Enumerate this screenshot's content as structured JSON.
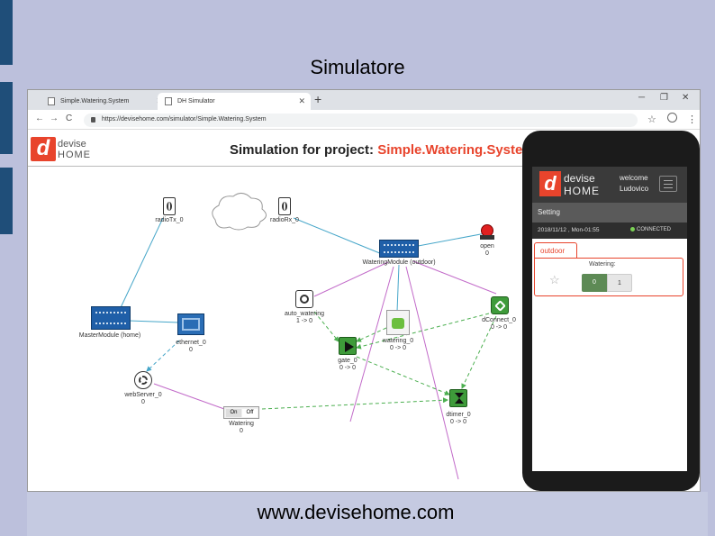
{
  "slide": {
    "title": "Simulatore",
    "footer_url": "www.devisehome.com"
  },
  "browser": {
    "tabs": [
      {
        "label": "Simple.Watering.System",
        "active": false
      },
      {
        "label": "DH Simulator",
        "active": true
      }
    ],
    "new_tab": "+",
    "window_controls": [
      "─",
      "❐",
      "✕"
    ],
    "nav": {
      "back": "←",
      "forward": "→",
      "reload": "C"
    },
    "address": "https://devisehome.com/simulator/Simple.Watering.System",
    "toolbar": {
      "star": "☆",
      "menu": "⋮"
    }
  },
  "app": {
    "logo": {
      "d": "d",
      "devise": "devise",
      "home": "HOME"
    },
    "title_prefix": "Simulation for project: ",
    "project_name": "Simple.Watering.System"
  },
  "nodes": [
    {
      "id": "radioTx",
      "label": "radioTx_0",
      "value": "",
      "icon": "radio-transmitter-icon"
    },
    {
      "id": "cloud",
      "label": "",
      "value": "",
      "icon": "cloud-icon"
    },
    {
      "id": "radioRx",
      "label": "radioRx_0",
      "value": "",
      "icon": "radio-receiver-icon"
    },
    {
      "id": "wateringModule",
      "label": "WateringModule (outdoor)",
      "value": "",
      "icon": "board-icon"
    },
    {
      "id": "open",
      "label": "open",
      "value": "0",
      "icon": "red-button-icon"
    },
    {
      "id": "autoWatering",
      "label": "auto_watering",
      "value": "1 -> 0",
      "icon": "sensor-icon"
    },
    {
      "id": "dConnect",
      "label": "dConnect_0",
      "value": "0 -> 0",
      "icon": "plug-icon"
    },
    {
      "id": "masterModule",
      "label": "MasterModule (home)",
      "value": "",
      "icon": "board-icon"
    },
    {
      "id": "ethernet",
      "label": "ethernet_0",
      "value": "0",
      "icon": "ethernet-shield-icon"
    },
    {
      "id": "watering",
      "label": "watering_0",
      "value": "0 -> 0",
      "icon": "watering-can-icon"
    },
    {
      "id": "gate",
      "label": "gate_0",
      "value": "0 -> 0",
      "icon": "play-gate-icon"
    },
    {
      "id": "webServer",
      "label": "webServer_0",
      "value": "0",
      "icon": "web-server-icon"
    },
    {
      "id": "timer",
      "label": "dtimer_0",
      "value": "0 -> 0",
      "icon": "hourglass-icon"
    },
    {
      "id": "wateringSwitch",
      "label": "Watering",
      "value": "0",
      "icon": "switch-icon",
      "on": "On",
      "off": "Off"
    }
  ],
  "colors": {
    "accent": "#e8442c",
    "link_blue": "#46a6c9",
    "link_purple": "#c26bc9",
    "link_green": "#4caf50",
    "connected": "#7bd155"
  },
  "phone": {
    "logo": {
      "d": "d",
      "devise": "devise",
      "home": "HOME"
    },
    "welcome": "welcome",
    "user": "Ludovico",
    "setting": "Setting",
    "datetime": "2018/11/12 , Mon-01:55",
    "status": "CONNECTED",
    "tab": "outdoor",
    "control_label": "Watering:",
    "star": "☆",
    "buttons": [
      "0",
      "1"
    ]
  }
}
